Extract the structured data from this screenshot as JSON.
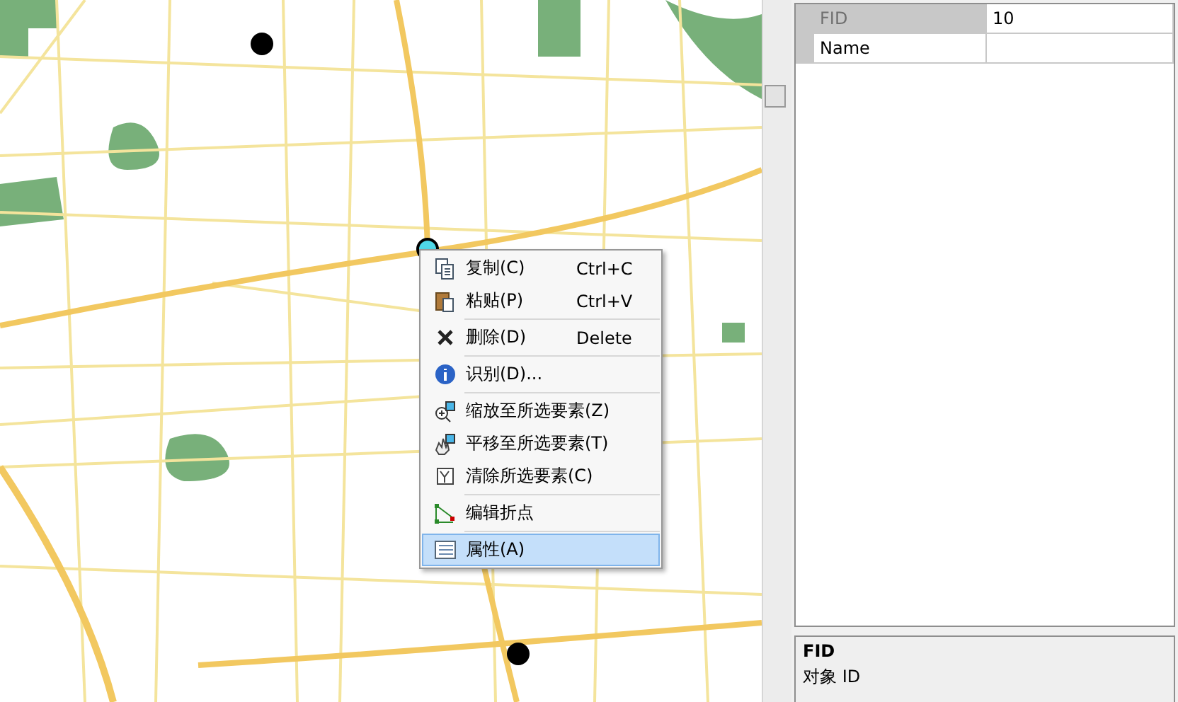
{
  "context_menu": {
    "groups": [
      [
        {
          "kind": "copy",
          "label": "复制(C)",
          "shortcut": "Ctrl+C",
          "selected": false
        },
        {
          "kind": "paste",
          "label": "粘贴(P)",
          "shortcut": "Ctrl+V",
          "selected": false
        }
      ],
      [
        {
          "kind": "delete",
          "label": "删除(D)",
          "shortcut": "Delete",
          "selected": false
        }
      ],
      [
        {
          "kind": "info",
          "label": "识别(D)...",
          "selected": false
        }
      ],
      [
        {
          "kind": "zoom",
          "label": "缩放至所选要素(Z)",
          "selected": false
        },
        {
          "kind": "pan",
          "label": "平移至所选要素(T)",
          "selected": false
        },
        {
          "kind": "clear",
          "label": "清除所选要素(C)",
          "selected": false
        }
      ],
      [
        {
          "kind": "vertices",
          "label": "编辑折点",
          "selected": false
        }
      ],
      [
        {
          "kind": "table",
          "label": "属性(A)",
          "selected": true
        }
      ]
    ]
  },
  "attributes": {
    "rows": [
      {
        "field": "FID",
        "value": "10",
        "readonly": true
      },
      {
        "field": "Name",
        "readonly": false
      }
    ]
  },
  "description": {
    "title": "FID",
    "text": "对象 ID"
  }
}
